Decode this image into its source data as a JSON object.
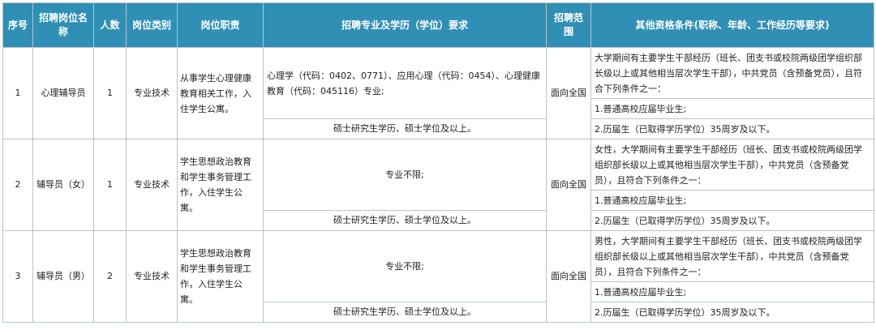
{
  "headers": {
    "no": "序号",
    "position": "招聘岗位名称",
    "count": "人数",
    "category": "岗位类别",
    "duty": "岗位职责",
    "major": "招聘专业及学历（学位）要求",
    "scope": "招聘范围",
    "other": "其他资格条件(职称、年龄、工作经历等要求)"
  },
  "rows": [
    {
      "no": "1",
      "position": "心理辅导员",
      "count": "1",
      "category": "专业技术",
      "duty": "从事学生心理健康教育相关工作，入住学生公寓。",
      "major": "心理学（代码：0402、0771）、应用心理（代码：0454）、心理健康教育（代码：045116）专业;",
      "degree": "硕士研究生学历、硕士学位及以上。",
      "scope": "面向全国",
      "req_main": "大学期间有主要学生干部经历（班长、团支书或校院两级团学组织部长级以上或其他相当层次学生干部），中共党员（含预备党员），且符合下列条件之一：",
      "req_1": "1.普通高校应届毕业生;",
      "req_2": "2.历届生（已取得学历学位）35周岁及以下。"
    },
    {
      "no": "2",
      "position": "辅导员（女）",
      "count": "1",
      "category": "专业技术",
      "duty": "学生思想政治教育和学生事务管理工作，入住学生公寓。",
      "major": "专业不限;",
      "degree": "硕士研究生学历、硕士学位及以上。",
      "scope": "面向全国",
      "req_main": "女性，大学期间有主要学生干部经历（班长、团支书或校院两级团学组织部长级以上或其他相当层次学生干部），中共党员（含预备党员），且符合下列条件之一：",
      "req_1": "1.普通高校应届毕业生;",
      "req_2": "2.历届生（已取得学历学位）35周岁及以下。"
    },
    {
      "no": "3",
      "position": "辅导员（男）",
      "count": "2",
      "category": "专业技术",
      "duty": "学生思想政治教育和学生事务管理工作，入住学生公寓。",
      "major": "专业不限;",
      "degree": "硕士研究生学历、硕士学位及以上。",
      "scope": "面向全国",
      "req_main": "男性，大学期间有主要学生干部经历（班长、团支书或校院两级团学组织部长级以上或其他相当层次学生干部），中共党员（含预备党员），且符合下列条件之一：",
      "req_1": "1.普通高校应届毕业生;",
      "req_2": "2.历届生（已取得学历学位）35周岁及以下。"
    }
  ]
}
